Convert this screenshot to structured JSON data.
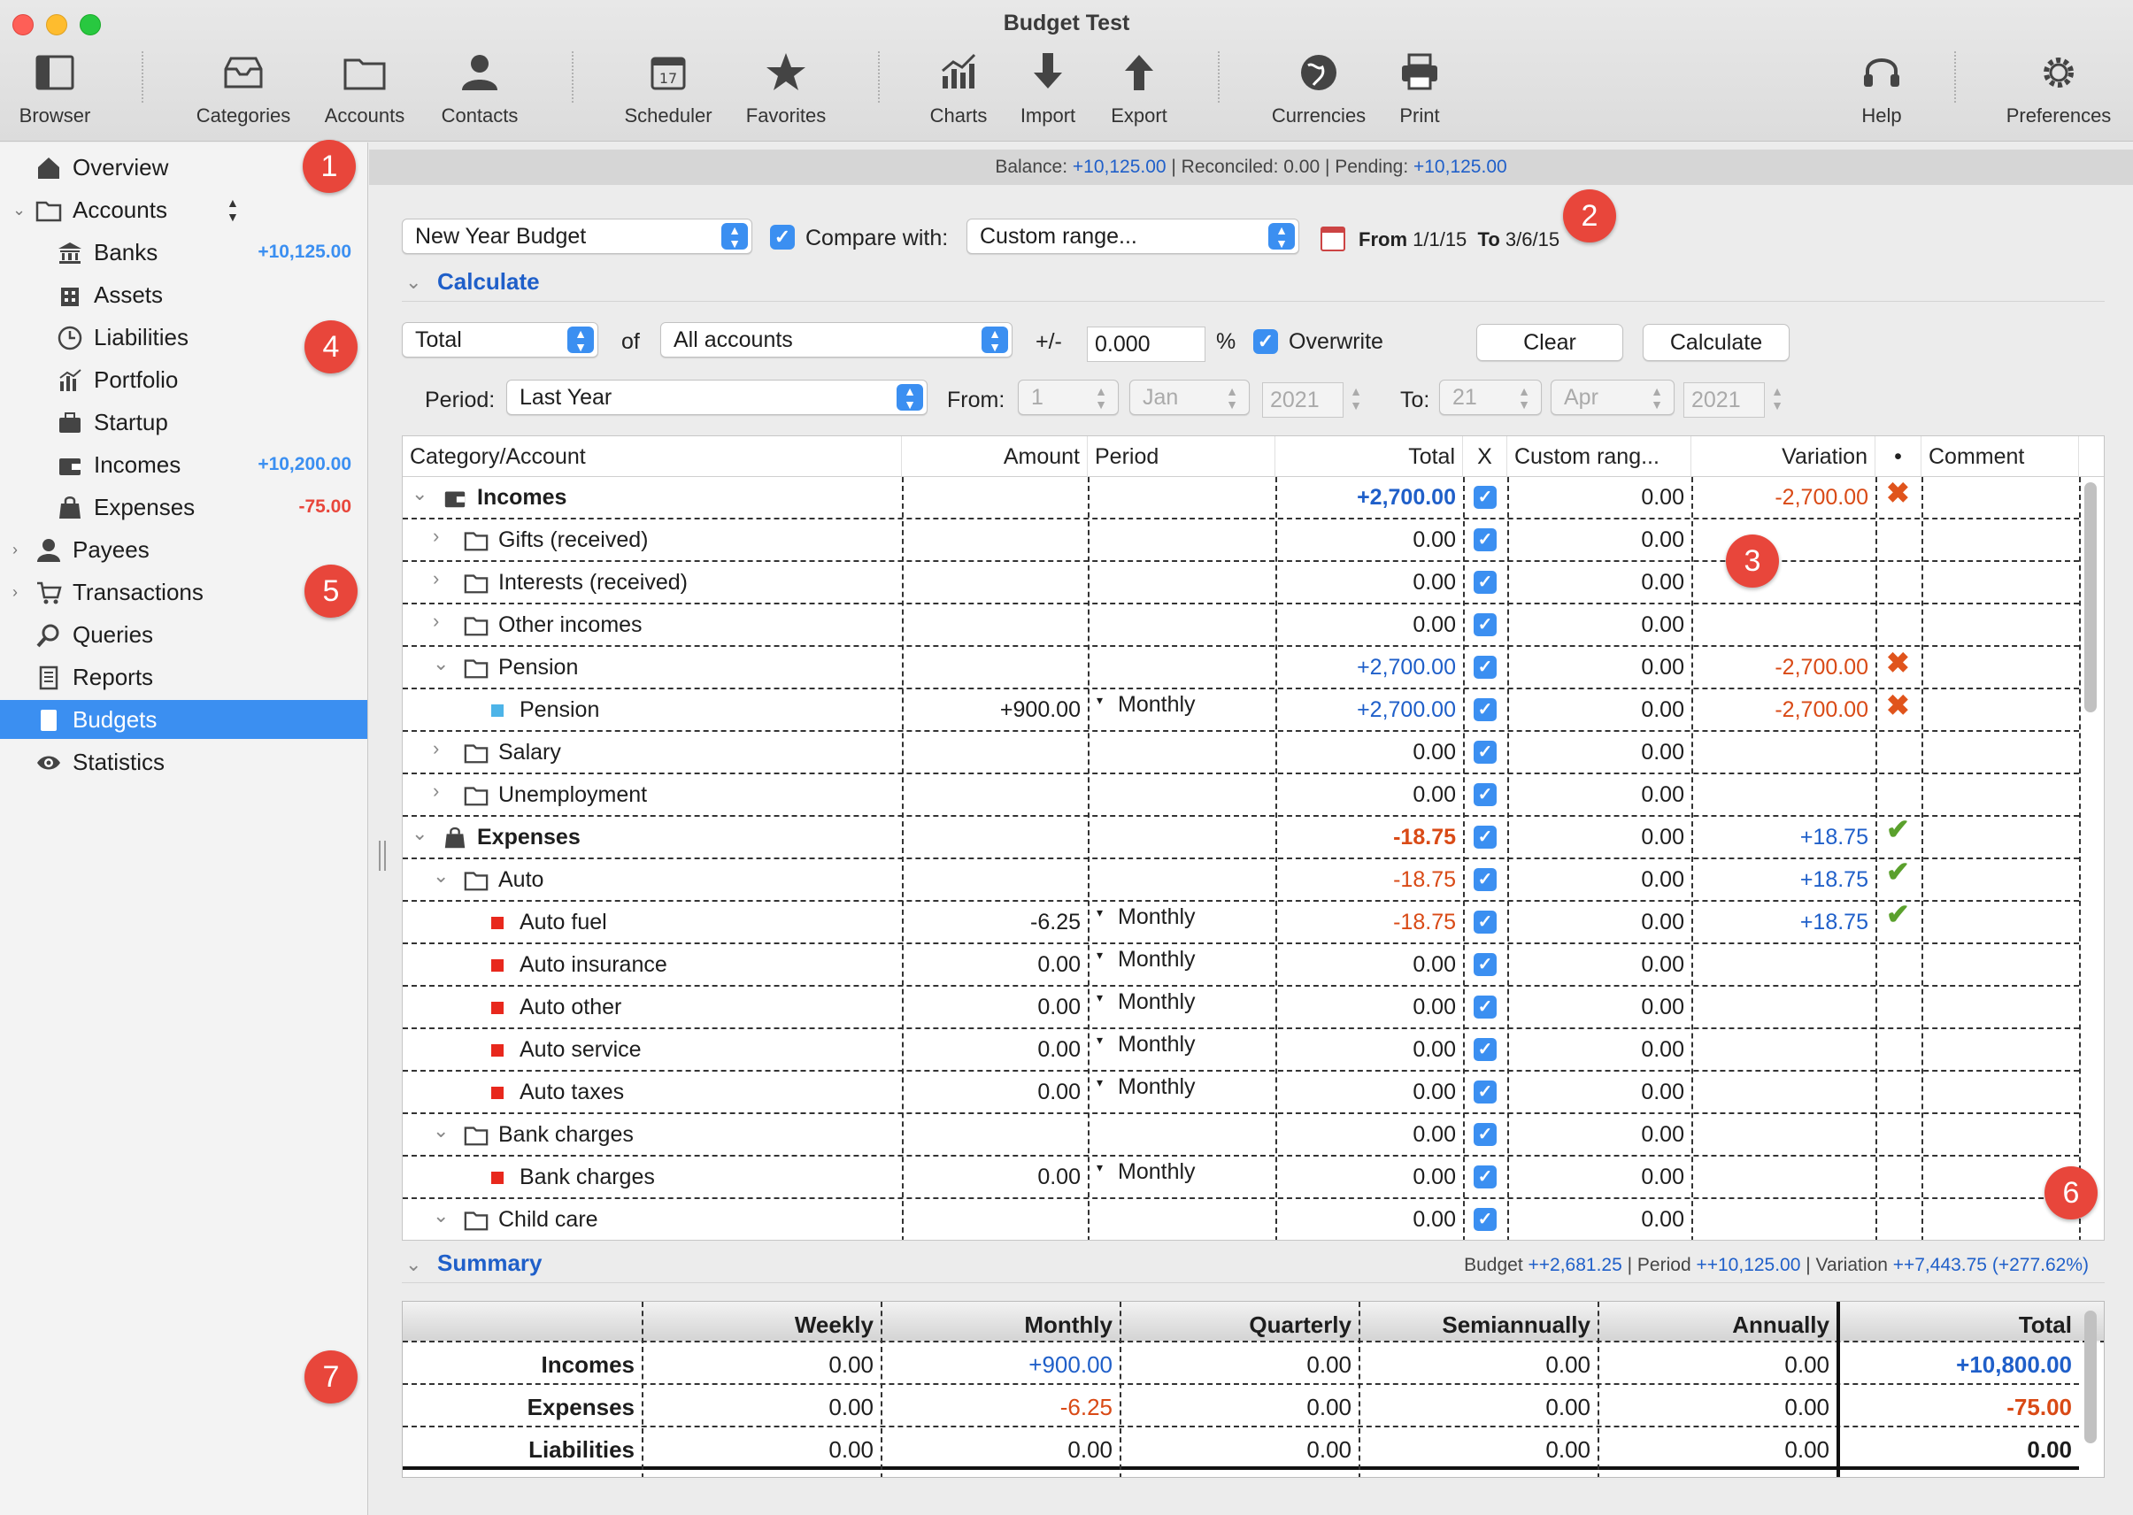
{
  "window": {
    "title": "Budget Test"
  },
  "toolbar": [
    {
      "id": "browser",
      "label": "Browser"
    },
    {
      "id": "categories",
      "label": "Categories"
    },
    {
      "id": "accounts",
      "label": "Accounts"
    },
    {
      "id": "contacts",
      "label": "Contacts"
    },
    {
      "id": "scheduler",
      "label": "Scheduler"
    },
    {
      "id": "favorites",
      "label": "Favorites"
    },
    {
      "id": "charts",
      "label": "Charts"
    },
    {
      "id": "import",
      "label": "Import"
    },
    {
      "id": "export",
      "label": "Export"
    },
    {
      "id": "currencies",
      "label": "Currencies"
    },
    {
      "id": "print",
      "label": "Print"
    },
    {
      "id": "help",
      "label": "Help"
    },
    {
      "id": "preferences",
      "label": "Preferences"
    }
  ],
  "sidebar": {
    "items": [
      {
        "label": "Overview",
        "icon": "house-icon"
      },
      {
        "label": "Accounts",
        "icon": "folder-icon"
      },
      {
        "label": "Banks",
        "amount": "+10,125.00",
        "icon": "bank-icon"
      },
      {
        "label": "Assets",
        "icon": "building-icon"
      },
      {
        "label": "Liabilities",
        "icon": "clock-icon"
      },
      {
        "label": "Portfolio",
        "icon": "chart-icon"
      },
      {
        "label": "Startup",
        "icon": "briefcase-icon"
      },
      {
        "label": "Incomes",
        "amount": "+10,200.00",
        "icon": "wallet-icon"
      },
      {
        "label": "Expenses",
        "amount": "-75.00",
        "icon": "bag-icon"
      },
      {
        "label": "Payees",
        "icon": "person-icon"
      },
      {
        "label": "Transactions",
        "icon": "cart-icon"
      },
      {
        "label": "Queries",
        "icon": "magnifier-icon"
      },
      {
        "label": "Reports",
        "icon": "document-icon"
      },
      {
        "label": "Budgets",
        "icon": "calculator-icon"
      },
      {
        "label": "Statistics",
        "icon": "eye-icon"
      }
    ]
  },
  "balance": {
    "prefix": "Balance: ",
    "balance": "+10,125.00",
    "reconciled": " | Reconciled: 0.00 | Pending: ",
    "pending": "+10,125.00"
  },
  "budget": {
    "name": "New Year Budget",
    "compare_label": "Compare with:",
    "compare_value": "Custom range...",
    "from_label": "From",
    "from": "1/1/15",
    "to_label": "To",
    "to": "3/6/15"
  },
  "calculate": {
    "title": "Calculate",
    "mode": "Total",
    "of": "of",
    "accounts": "All accounts",
    "plusminus": "+/-",
    "percent": "0.000",
    "pct_sign": "%",
    "overwrite": "Overwrite",
    "clear": "Clear",
    "calculate": "Calculate",
    "period_label": "Period:",
    "period": "Last Year",
    "from_label": "From:",
    "from_day": "1",
    "from_month": "Jan",
    "from_year": "2021",
    "to_label": "To:",
    "to_day": "21",
    "to_month": "Apr",
    "to_year": "2021"
  },
  "grid": {
    "headers": [
      "Category/Account",
      "Amount",
      "Period",
      "Total",
      "X",
      "Custom rang...",
      "Variation",
      "•",
      "Comment"
    ],
    "rows": [
      {
        "name": "Incomes",
        "level": 0,
        "bold": true,
        "icon": "wallet-icon",
        "amount": "",
        "period": "",
        "total": "+2,700.00",
        "tc": "blue",
        "custom": "0.00",
        "variation": "-2,700.00",
        "vc": "red",
        "mark": "x"
      },
      {
        "name": "Gifts (received)",
        "level": 1,
        "icon": "folder-icon",
        "amount": "",
        "period": "",
        "total": "0.00",
        "custom": "0.00",
        "variation": "",
        "mark": ""
      },
      {
        "name": "Interests (received)",
        "level": 1,
        "icon": "folder-icon",
        "amount": "",
        "period": "",
        "total": "0.00",
        "custom": "0.00",
        "variation": "",
        "mark": ""
      },
      {
        "name": "Other incomes",
        "level": 1,
        "icon": "folder-icon",
        "amount": "",
        "period": "",
        "total": "0.00",
        "custom": "0.00",
        "variation": "",
        "mark": ""
      },
      {
        "name": "Pension",
        "level": 1,
        "open": true,
        "icon": "folder-icon",
        "amount": "",
        "period": "",
        "total": "+2,700.00",
        "tc": "blue",
        "custom": "0.00",
        "variation": "-2,700.00",
        "vc": "red",
        "mark": "x"
      },
      {
        "name": "Pension",
        "level": 2,
        "sq": "#4db4e8",
        "amount": "+900.00",
        "period": "Monthly",
        "total": "+2,700.00",
        "tc": "blue",
        "custom": "0.00",
        "variation": "-2,700.00",
        "vc": "red",
        "mark": "x"
      },
      {
        "name": "Salary",
        "level": 1,
        "icon": "folder-icon",
        "amount": "",
        "period": "",
        "total": "0.00",
        "custom": "0.00",
        "variation": "",
        "mark": ""
      },
      {
        "name": "Unemployment",
        "level": 1,
        "icon": "folder-icon",
        "amount": "",
        "period": "",
        "total": "0.00",
        "custom": "0.00",
        "variation": "",
        "mark": ""
      },
      {
        "name": "Expenses",
        "level": 0,
        "bold": true,
        "icon": "bag-icon",
        "amount": "",
        "period": "",
        "total": "-18.75",
        "tc": "red",
        "custom": "0.00",
        "variation": "+18.75",
        "vc": "blue",
        "mark": "v"
      },
      {
        "name": "Auto",
        "level": 1,
        "open": true,
        "icon": "folder-icon",
        "amount": "",
        "period": "",
        "total": "-18.75",
        "tc": "red",
        "custom": "0.00",
        "variation": "+18.75",
        "vc": "blue",
        "mark": "v"
      },
      {
        "name": "Auto fuel",
        "level": 2,
        "sq": "#e8281d",
        "amount": "-6.25",
        "period": "Monthly",
        "total": "-18.75",
        "tc": "red",
        "custom": "0.00",
        "variation": "+18.75",
        "vc": "blue",
        "mark": "v"
      },
      {
        "name": "Auto insurance",
        "level": 2,
        "sq": "#e8281d",
        "amount": "0.00",
        "period": "Monthly",
        "total": "0.00",
        "custom": "0.00",
        "variation": "",
        "mark": ""
      },
      {
        "name": "Auto other",
        "level": 2,
        "sq": "#e8281d",
        "amount": "0.00",
        "period": "Monthly",
        "total": "0.00",
        "custom": "0.00",
        "variation": "",
        "mark": ""
      },
      {
        "name": "Auto service",
        "level": 2,
        "sq": "#e8281d",
        "amount": "0.00",
        "period": "Monthly",
        "total": "0.00",
        "custom": "0.00",
        "variation": "",
        "mark": ""
      },
      {
        "name": "Auto taxes",
        "level": 2,
        "sq": "#e8281d",
        "amount": "0.00",
        "period": "Monthly",
        "total": "0.00",
        "custom": "0.00",
        "variation": "",
        "mark": ""
      },
      {
        "name": "Bank charges",
        "level": 1,
        "open": true,
        "icon": "folder-icon",
        "amount": "",
        "period": "",
        "total": "0.00",
        "custom": "0.00",
        "variation": "",
        "mark": ""
      },
      {
        "name": "Bank charges",
        "level": 2,
        "sq": "#e8281d",
        "amount": "0.00",
        "period": "Monthly",
        "total": "0.00",
        "custom": "0.00",
        "variation": "",
        "mark": ""
      },
      {
        "name": "Child care",
        "level": 1,
        "open": true,
        "icon": "folder-icon",
        "amount": "",
        "period": "",
        "total": "0.00",
        "custom": "0.00",
        "variation": "",
        "mark": ""
      }
    ]
  },
  "summary": {
    "title": "Summary",
    "budget_label": "Budget ",
    "budget": "++2,681.25",
    "period_label": " | Period ",
    "period": "++10,125.00",
    "variation_label": " | Variation ",
    "variation": "++7,443.75",
    "variation_pct": "(+277.62%)",
    "headers": [
      "Weekly",
      "Monthly",
      "Quarterly",
      "Semiannually",
      "Annually",
      "Total"
    ],
    "rows": [
      {
        "label": "Incomes",
        "values": [
          "0.00",
          "+900.00",
          "0.00",
          "0.00",
          "0.00",
          "+10,800.00"
        ],
        "colors": [
          "",
          "blue",
          "",
          "",
          "",
          "blue"
        ]
      },
      {
        "label": "Expenses",
        "values": [
          "0.00",
          "-6.25",
          "0.00",
          "0.00",
          "0.00",
          "-75.00"
        ],
        "colors": [
          "",
          "red",
          "",
          "",
          "",
          "red"
        ]
      },
      {
        "label": "Liabilities",
        "values": [
          "0.00",
          "0.00",
          "0.00",
          "0.00",
          "0.00",
          "0.00"
        ],
        "colors": [
          "",
          "",
          "",
          "",
          "",
          ""
        ]
      }
    ]
  },
  "callouts": [
    "1",
    "2",
    "3",
    "4",
    "5",
    "6",
    "7"
  ],
  "colors": {
    "accent": "#3b8ff1",
    "positive": "#1f5fc9",
    "negative": "#d94a16",
    "callout": "#e8463b"
  }
}
